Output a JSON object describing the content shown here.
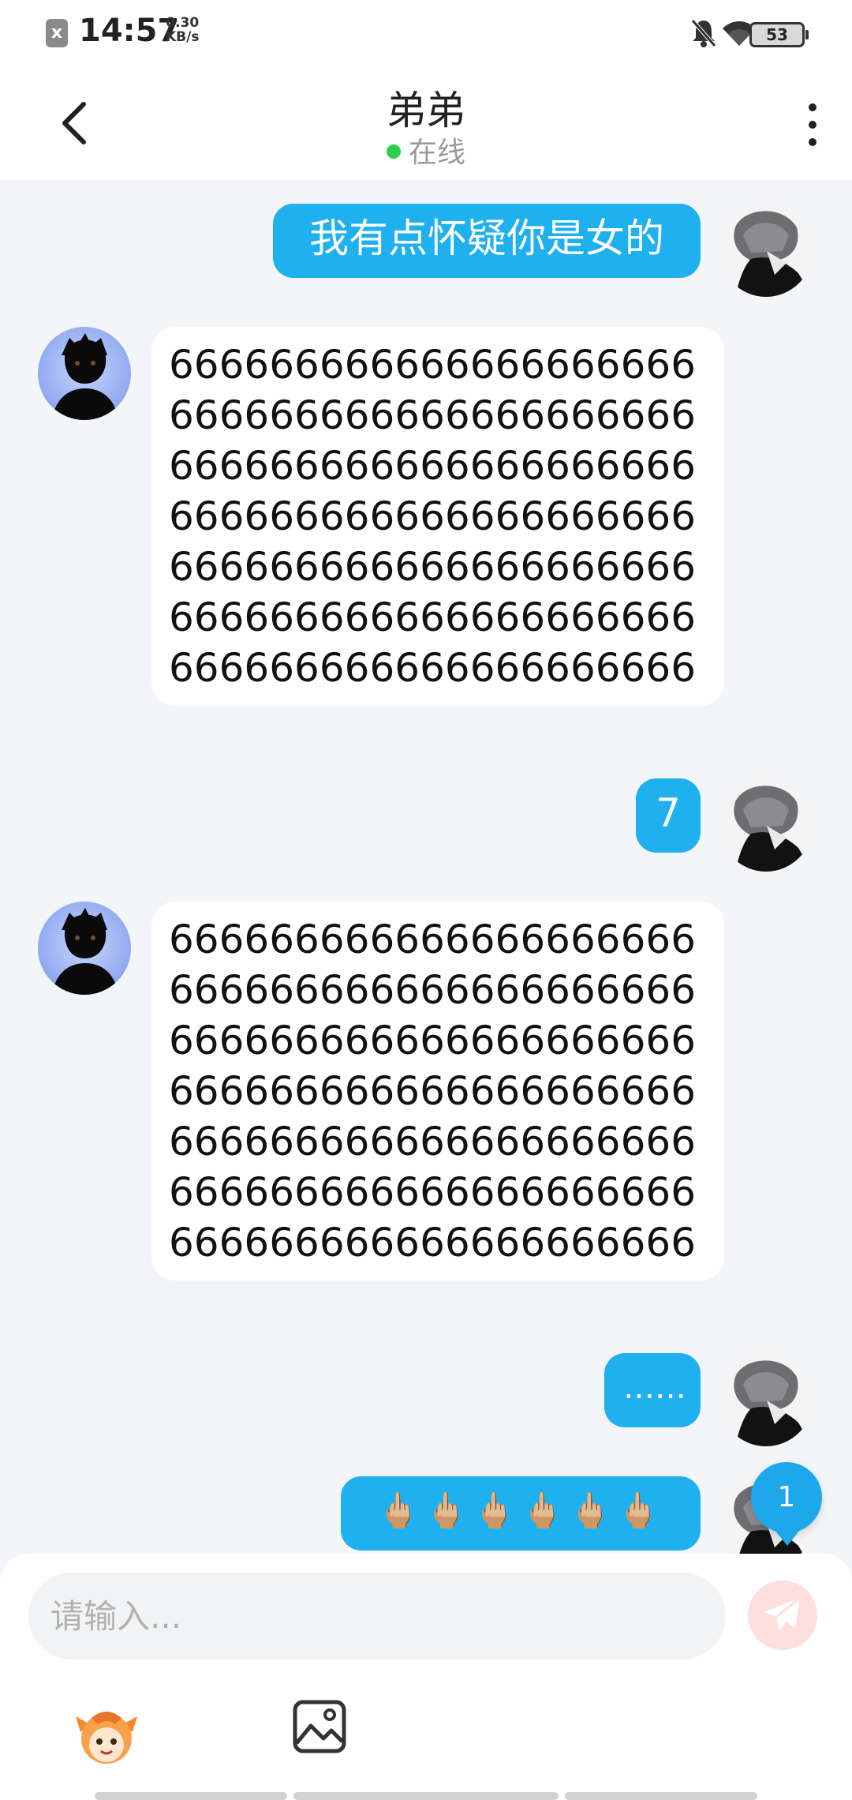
{
  "status_bar": {
    "sim_icon": "x",
    "time": "14:57",
    "speed_value": "0.30",
    "speed_unit": "KB/s",
    "battery": "53"
  },
  "header": {
    "title": "弟弟",
    "status": "在线",
    "icons": [
      "back-arrow-icon",
      "more-vertical-icon"
    ]
  },
  "messages": [
    {
      "from": "me",
      "text": "我有点怀疑你是女的"
    },
    {
      "from": "other",
      "text": "666666666666666666666666666666666666666666666666666666666666666666666666666666666666666666666666666666666666666666666666666666666666666666666666666"
    },
    {
      "from": "me",
      "text": "7"
    },
    {
      "from": "other",
      "text": "666666666666666666666666666666666666666666666666666666666666666666666666666666666666666666666666666666666666666666666666666666666666666666666666666"
    },
    {
      "from": "me",
      "text": "……"
    },
    {
      "from": "me",
      "text": "🖕🏼🖕🏼🖕🏼🖕🏼🖕🏼🖕🏼"
    }
  ],
  "unread_badge": "1",
  "composer": {
    "placeholder": "请输入...",
    "icons": [
      "send-icon",
      "emoji-mascot-icon",
      "image-icon"
    ]
  },
  "colors": {
    "my_bubble": "#1fb0f0",
    "other_bubble": "#ffffff",
    "background": "#f3f5f8",
    "online": "#2fcf4b"
  }
}
